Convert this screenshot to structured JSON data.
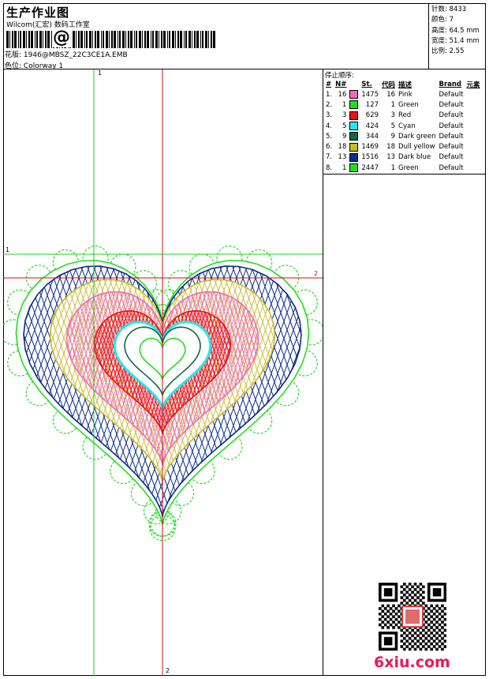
{
  "header": {
    "title": "生产作业图",
    "company": "Wilcom(汇宏) 数码工作室",
    "barcode_char": "@",
    "file_label": "花版:",
    "file_name": "1946@MBSZ_22C3CE1A.EMB",
    "colorway_label": "色位:",
    "colorway_value": "Colorway 1"
  },
  "stats": [
    "针数: 8433",
    "颜色: 7",
    "高度: 64.5 mm",
    "宽度: 51.4 mm",
    "比例: 2.55"
  ],
  "sequence": {
    "title": "停止顺序:",
    "columns": [
      "#",
      "N#",
      "St.",
      "代码",
      "描述",
      "Brand",
      "元素"
    ],
    "rows": [
      {
        "idx": "1.",
        "n": "16",
        "color": "#f06ab8",
        "st": "1475",
        "code": "16",
        "desc": "Pink",
        "brand": "Default"
      },
      {
        "idx": "2.",
        "n": "1",
        "color": "#22dd22",
        "st": "127",
        "code": "1",
        "desc": "Green",
        "brand": "Default"
      },
      {
        "idx": "3.",
        "n": "3",
        "color": "#ee1111",
        "st": "629",
        "code": "3",
        "desc": "Red",
        "brand": "Default"
      },
      {
        "idx": "4.",
        "n": "5",
        "color": "#22e8ee",
        "st": "424",
        "code": "5",
        "desc": "Cyan",
        "brand": "Default"
      },
      {
        "idx": "5.",
        "n": "9",
        "color": "#0c6a44",
        "st": "344",
        "code": "9",
        "desc": "Dark green",
        "brand": "Default"
      },
      {
        "idx": "6.",
        "n": "18",
        "color": "#c8b82a",
        "st": "1469",
        "code": "18",
        "desc": "Dull yellow",
        "brand": "Default"
      },
      {
        "idx": "7.",
        "n": "13",
        "color": "#0c2a8a",
        "st": "1516",
        "code": "13",
        "desc": "Dark blue",
        "brand": "Default"
      },
      {
        "idx": "8.",
        "n": "1",
        "color": "#22dd22",
        "st": "2447",
        "code": "1",
        "desc": "Green",
        "brand": "Default"
      }
    ]
  },
  "axis_labels": {
    "v1": "1",
    "v2": "2",
    "h1": "1",
    "h2": "2"
  },
  "watermark": "6xiu.com"
}
